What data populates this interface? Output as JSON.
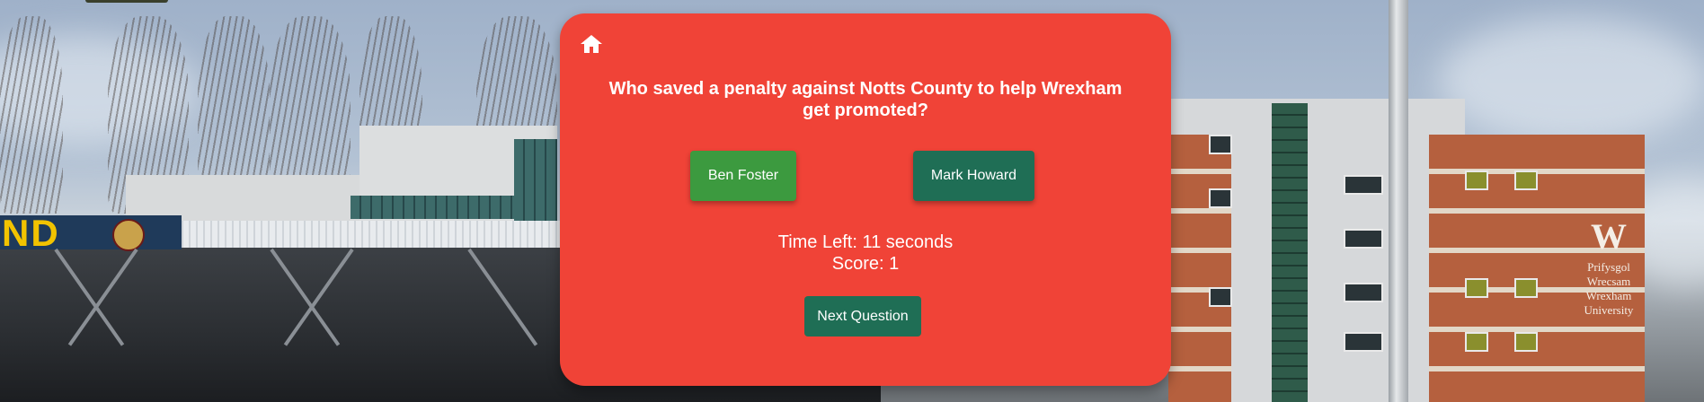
{
  "quiz": {
    "question": "Who saved a penalty against Notts County to help Wrexham get promoted?",
    "answers": [
      "Ben Foster",
      "Mark Howard"
    ],
    "timer_text": "Time Left: 11 seconds",
    "score_text": "Score: 1",
    "next_label": "Next Question",
    "home_icon": "home-icon"
  },
  "background": {
    "stand_sign": "ND",
    "university_logo": "W",
    "university_text": "Prifysgol Wrecsam Wrexham University"
  },
  "colors": {
    "card": "#f04337",
    "answer_primary": "#3c9a3f",
    "answer_secondary": "#1f6e55",
    "next_button": "#1f6e55"
  }
}
